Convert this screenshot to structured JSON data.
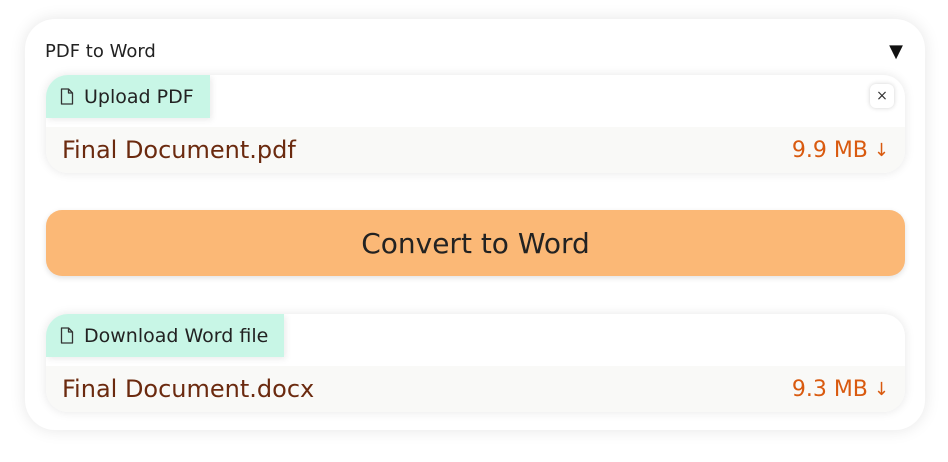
{
  "card": {
    "title": "PDF to Word",
    "toggle_icon": "▼"
  },
  "upload": {
    "label": "Upload PDF",
    "icon": "document-icon",
    "close_glyph": "×",
    "file": {
      "name": "Final Document.pdf",
      "size": "9.9 MB",
      "arrow": "↓"
    }
  },
  "convert": {
    "label": "Convert to Word",
    "color": "#fbb876"
  },
  "download": {
    "label": "Download Word file",
    "icon": "document-icon",
    "file": {
      "name": "Final Document.docx",
      "size": "9.3 MB",
      "arrow": "↓"
    }
  },
  "colors": {
    "label_bg": "#c8f6e6",
    "file_name": "#6b2a0f",
    "file_size": "#d95a0f"
  }
}
